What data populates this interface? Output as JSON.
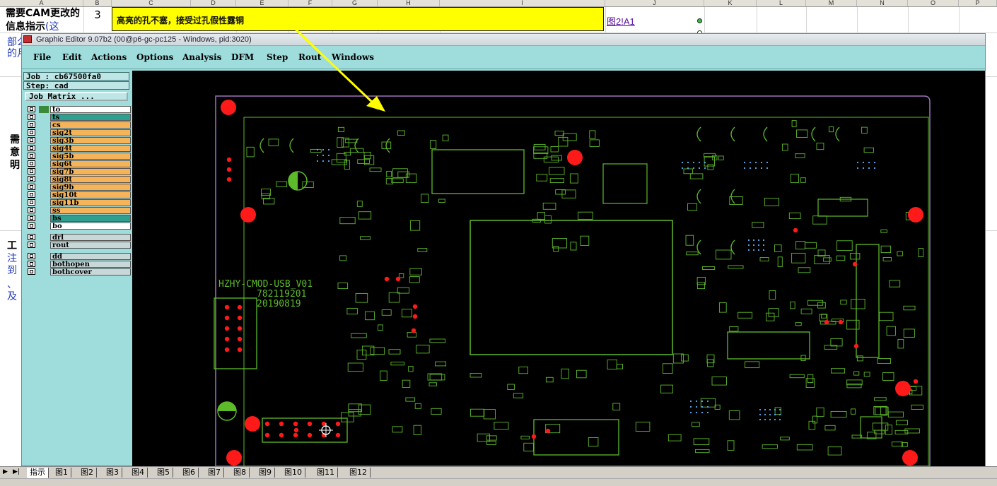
{
  "sheet": {
    "columns": [
      "A",
      "B",
      "C",
      "D",
      "E",
      "F",
      "G",
      "H",
      "I",
      "J",
      "K",
      "L",
      "M",
      "N",
      "O",
      "P"
    ],
    "cellA1_bold": "需要CAM更改的信息指示",
    "cellA1_blue": "(这",
    "row_number": "3",
    "yellow_text": "高亮的孔不塞，接受过孔假性露铜",
    "link": "图2!A1",
    "side_frag_1": "部么",
    "side_frag_2": "的月",
    "side_frag_3": "需",
    "side_frag_4": "意",
    "side_frag_5": "明",
    "side_frag_6": "工",
    "side_frag_7": "注",
    "side_frag_8": "到",
    "side_frag_9": "、",
    "side_frag_10": "及"
  },
  "sheet_tabs": [
    "指示",
    "图1",
    "图2",
    "图3",
    "图4",
    "图5",
    "图6",
    "图7",
    "图8",
    "图9",
    "图10",
    "图11",
    "图12"
  ],
  "editor": {
    "title": "Graphic Editor 9.07b2 (00@p6-gc-pc125 - Windows, pid:3020)",
    "menus": [
      "File",
      "Edit",
      "Actions",
      "Options",
      "Analysis",
      "DFM",
      "Step",
      "Rout",
      "Windows"
    ],
    "job_label": "Job : cb67500fa0",
    "step_label": "Step: cad",
    "job_matrix_label": "Job Matrix ...",
    "layers": [
      {
        "name": "to",
        "color": "#ffffff",
        "tag": "#3a8a3a"
      },
      {
        "name": "ts",
        "color": "#2f9f8f",
        "tag": ""
      },
      {
        "name": "cs",
        "color": "#f6b45a",
        "tag": ""
      },
      {
        "name": "sig2t",
        "color": "#f6b45a",
        "tag": ""
      },
      {
        "name": "sig3b",
        "color": "#f6b45a",
        "tag": ""
      },
      {
        "name": "sig4t",
        "color": "#f6b45a",
        "tag": ""
      },
      {
        "name": "sig5b",
        "color": "#f6b45a",
        "tag": ""
      },
      {
        "name": "sig6t",
        "color": "#f6b45a",
        "tag": ""
      },
      {
        "name": "sig7b",
        "color": "#f6b45a",
        "tag": ""
      },
      {
        "name": "sig8t",
        "color": "#f6b45a",
        "tag": ""
      },
      {
        "name": "sig9b",
        "color": "#f6b45a",
        "tag": ""
      },
      {
        "name": "sig10t",
        "color": "#f6b45a",
        "tag": ""
      },
      {
        "name": "sig11b",
        "color": "#f6b45a",
        "tag": ""
      },
      {
        "name": "ss",
        "color": "#f6b45a",
        "tag": ""
      },
      {
        "name": "bs",
        "color": "#2f9f8f",
        "tag": ""
      },
      {
        "name": "bo",
        "color": "#ffffff",
        "tag": ""
      },
      {
        "name": "drl",
        "color": "#c8d8d8",
        "tag": ""
      },
      {
        "name": "rout",
        "color": "#c8d8d8",
        "tag": ""
      },
      {
        "name": "dd",
        "color": "#c8d8d8",
        "tag": ""
      },
      {
        "name": "bothopen",
        "color": "#c8d8d8",
        "tag": ""
      },
      {
        "name": "bothcover",
        "color": "#c8d8d8",
        "tag": ""
      }
    ],
    "board_text": {
      "line1": "HZHY-CMOD-USB_V01",
      "line2": "782119201",
      "line3": "20190819"
    }
  },
  "colors": {
    "pcb_green": "#5dbb2a",
    "highlight_red": "#ff1a1a",
    "yellow": "#ffff00",
    "editor_bg": "#9fdcdc"
  }
}
